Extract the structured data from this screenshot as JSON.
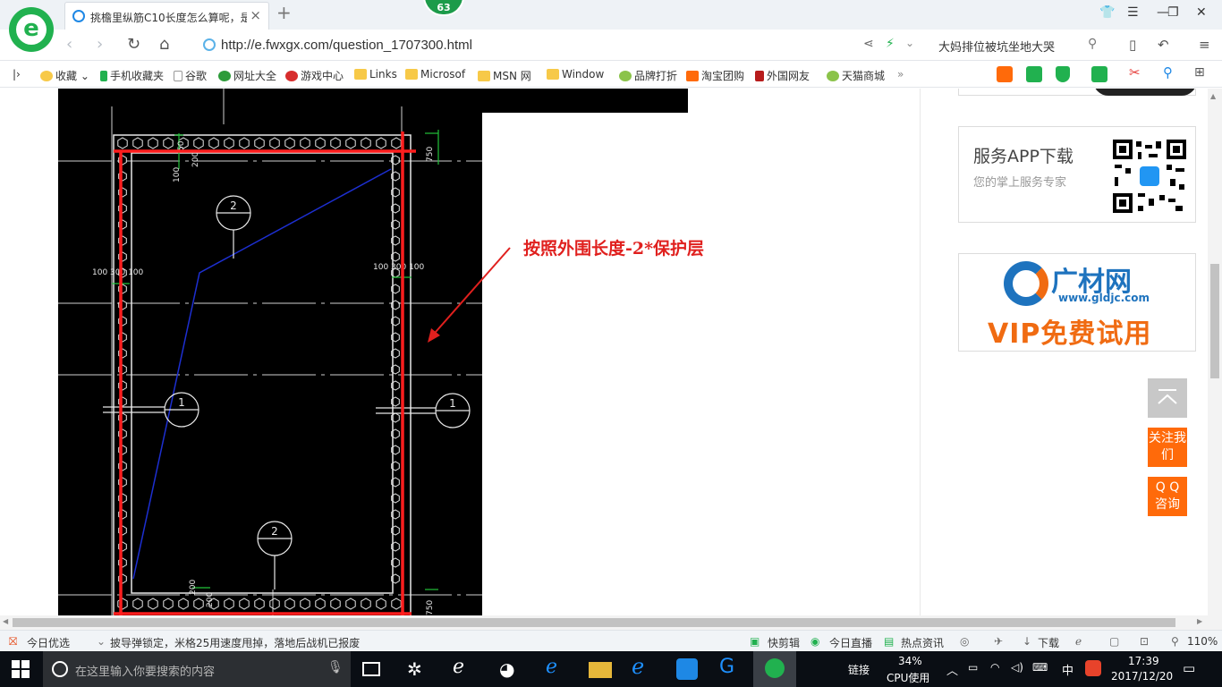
{
  "browser": {
    "tab_title": "挑檐里纵筋C10长度怎么算呢，是",
    "badge_count": "63",
    "url": "http://e.fwxgx.com/question_1707300.html",
    "hot_search": "大妈排位被坑坐地大哭",
    "new_tab_glyph": "+",
    "close_glyph": "×"
  },
  "bookmarks": [
    {
      "label": "收藏",
      "icon": "star-icon"
    },
    {
      "label": "手机收藏夹",
      "icon": "phone-icon"
    },
    {
      "label": "谷歌",
      "icon": "page-icon"
    },
    {
      "label": "网址大全",
      "icon": "site-icon"
    },
    {
      "label": "游戏中心",
      "icon": "game-icon"
    },
    {
      "label": "Links",
      "icon": "folder-icon"
    },
    {
      "label": "Microsof",
      "icon": "folder-icon"
    },
    {
      "label": "MSN 网",
      "icon": "folder-icon"
    },
    {
      "label": "Window",
      "icon": "folder-icon"
    },
    {
      "label": "品牌打折",
      "icon": "leaf-icon"
    },
    {
      "label": "淘宝团购",
      "icon": "taobao-icon"
    },
    {
      "label": "外国网友",
      "icon": "page-icon"
    },
    {
      "label": "天猫商城",
      "icon": "leaf-icon"
    }
  ],
  "drawing": {
    "annotation": "按照外围长度-2*保护层",
    "dims": {
      "d50": "50",
      "d200a": "200",
      "d100": "100",
      "d750": "750",
      "left_dims": "100  300 100",
      "right_dims": "100  300 100",
      "d200b": "200",
      "d200c": "200",
      "d750b": "750",
      "marker1": "1",
      "marker2": "2"
    }
  },
  "sidebar": {
    "app_title": "服务APP下载",
    "app_desc": "您的掌上服务专家",
    "ad_brand": "广材网",
    "ad_url": "www.gldjc.com",
    "ad_vip": "VIP免费试用",
    "follow_btn": "关注我们",
    "qq_btn": "Q Q 咨询"
  },
  "statusbar": {
    "today_pick": "今日优选",
    "news": "披导弹锁定，米格25用速度甩掉，落地后战机已报废",
    "quick_edit": "快剪辑",
    "live": "今日直播",
    "hot_news": "热点资讯",
    "download": "下载",
    "zoom": "110%"
  },
  "taskbar": {
    "search_placeholder": "在这里输入你要搜索的内容",
    "link_label": "链接",
    "cpu_percent": "34%",
    "cpu_label": "CPU使用",
    "ime": "中",
    "time": "17:39",
    "date": "2017/12/20"
  },
  "colors": {
    "annotation": "#e0201e",
    "brand_green": "#21b14f",
    "orange": "#ff6a0a"
  }
}
